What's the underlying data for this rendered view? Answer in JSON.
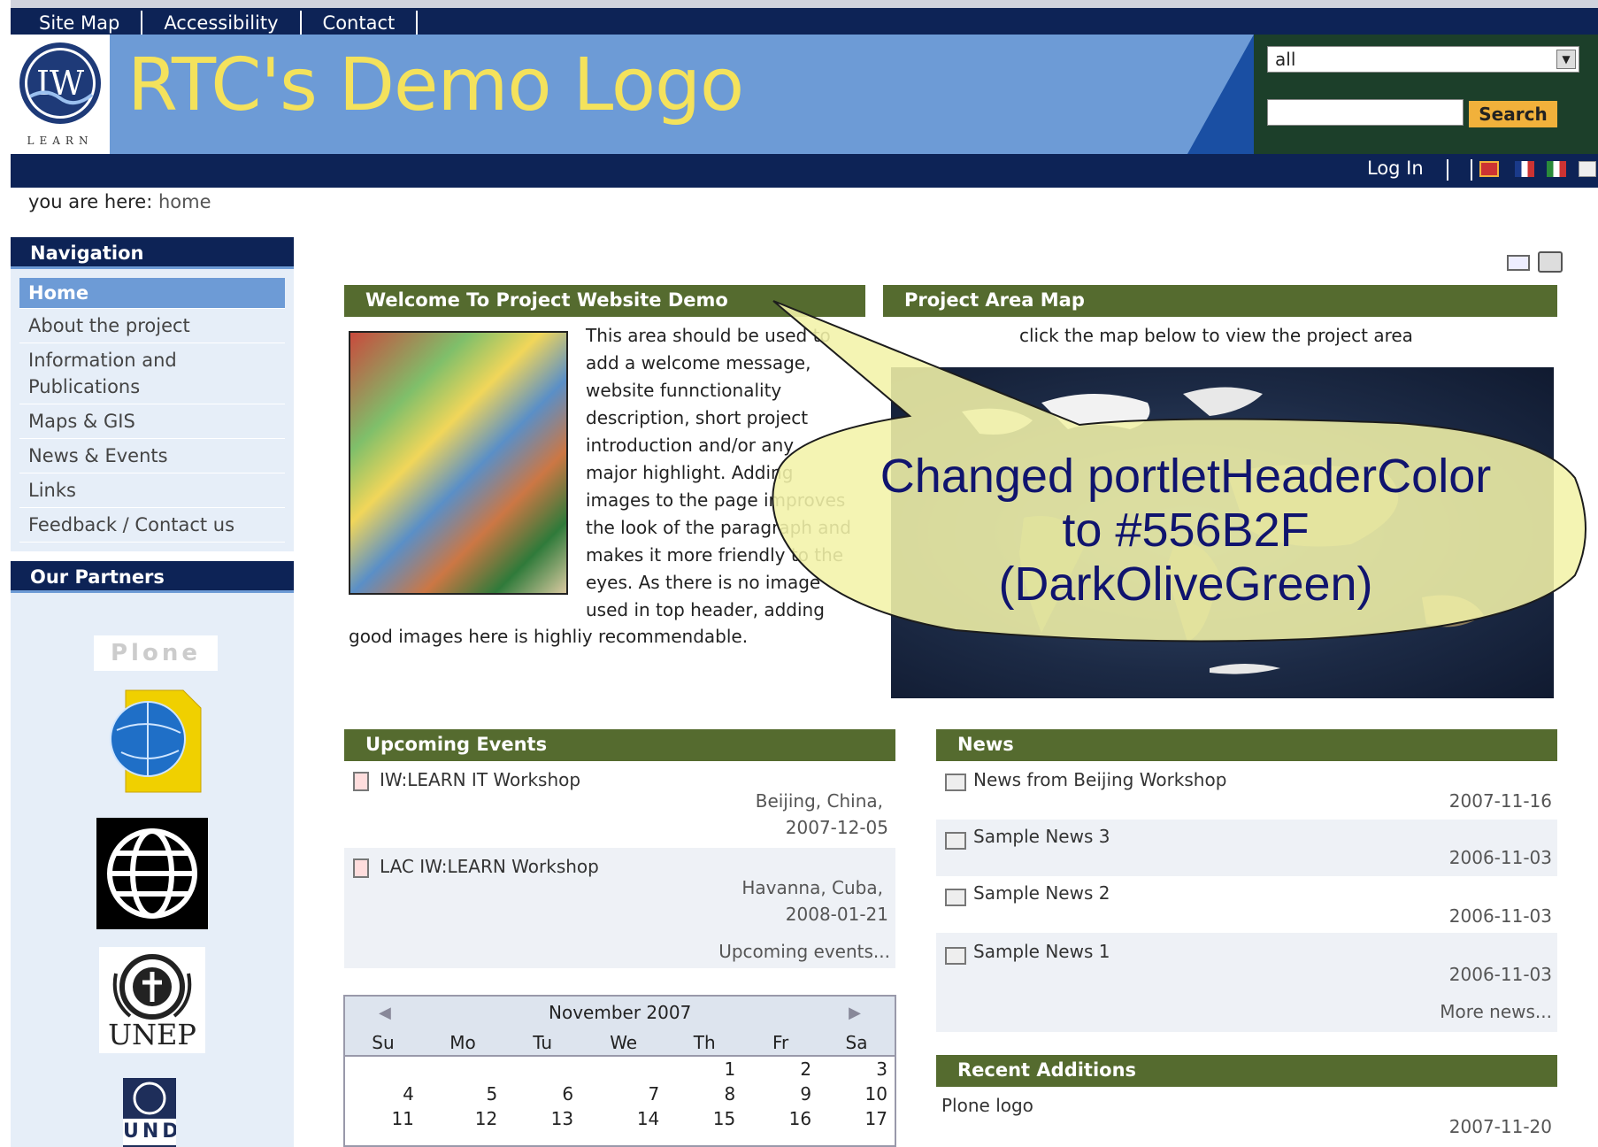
{
  "top_links": [
    "Site Map",
    "Accessibility",
    "Contact"
  ],
  "site_title": "RTC's Demo Logo",
  "logo_text": "IW",
  "logo_sub": "LEARN",
  "search": {
    "scope_value": "all",
    "button": "Search"
  },
  "login": "Log In",
  "breadcrumb": {
    "label": "you are here:",
    "current": "home"
  },
  "navigation": {
    "title": "Navigation",
    "items": [
      "Home",
      "About the project",
      "Information and Publications",
      "Maps & GIS",
      "News & Events",
      "Links",
      "Feedback / Contact us"
    ]
  },
  "partners": {
    "title": "Our Partners",
    "plone": "Plone",
    "unep": "UNEP",
    "undp": "UNDP"
  },
  "welcome": {
    "title": "Welcome To Project Website Demo",
    "lines": [
      "This area should be used to",
      "add a welcome message,",
      "website funnctionality",
      "description, short project",
      "introduction and/or any",
      "major  highlight. Adding",
      "images to the page improves",
      "the look of the paragraph and",
      "makes it more friendly to the",
      "eyes. As there is no image",
      "used in top header, adding"
    ],
    "last_line": "good images here is highliy recommendable."
  },
  "map": {
    "title": "Project Area Map",
    "caption": "click the map below to view the project area"
  },
  "callout": {
    "line1": "Changed portletHeaderColor",
    "line2": "to #556B2F",
    "line3": "(DarkOliveGreen)"
  },
  "events": {
    "title": "Upcoming Events",
    "items": [
      {
        "name": "IW:LEARN IT Workshop",
        "loc": "Beijing, China,",
        "date": "2007-12-05"
      },
      {
        "name": "LAC IW:LEARN Workshop",
        "loc": "Havanna, Cuba,",
        "date": "2008-01-21"
      }
    ],
    "more": "Upcoming events..."
  },
  "calendar": {
    "month": "November 2007",
    "days": [
      "Su",
      "Mo",
      "Tu",
      "We",
      "Th",
      "Fr",
      "Sa"
    ],
    "rows": [
      [
        "",
        "",
        "",
        "",
        "1",
        "2",
        "3"
      ],
      [
        "4",
        "5",
        "6",
        "7",
        "8",
        "9",
        "10"
      ],
      [
        "11",
        "12",
        "13",
        "14",
        "15",
        "16",
        "17"
      ]
    ]
  },
  "news": {
    "title": "News",
    "items": [
      {
        "name": "News from Beijing Workshop",
        "date": "2007-11-16"
      },
      {
        "name": "Sample News 3",
        "date": "2006-11-03"
      },
      {
        "name": "Sample News 2",
        "date": "2006-11-03"
      },
      {
        "name": "Sample News 1",
        "date": "2006-11-03"
      }
    ],
    "more": "More news..."
  },
  "recent": {
    "title": "Recent Additions",
    "items": [
      {
        "name": "Plone logo",
        "date": "2007-11-20"
      }
    ]
  },
  "colors": {
    "portlet_header": "#556B2F",
    "nav_dark": "#0d2356",
    "header_blue": "#6d9bd6"
  }
}
